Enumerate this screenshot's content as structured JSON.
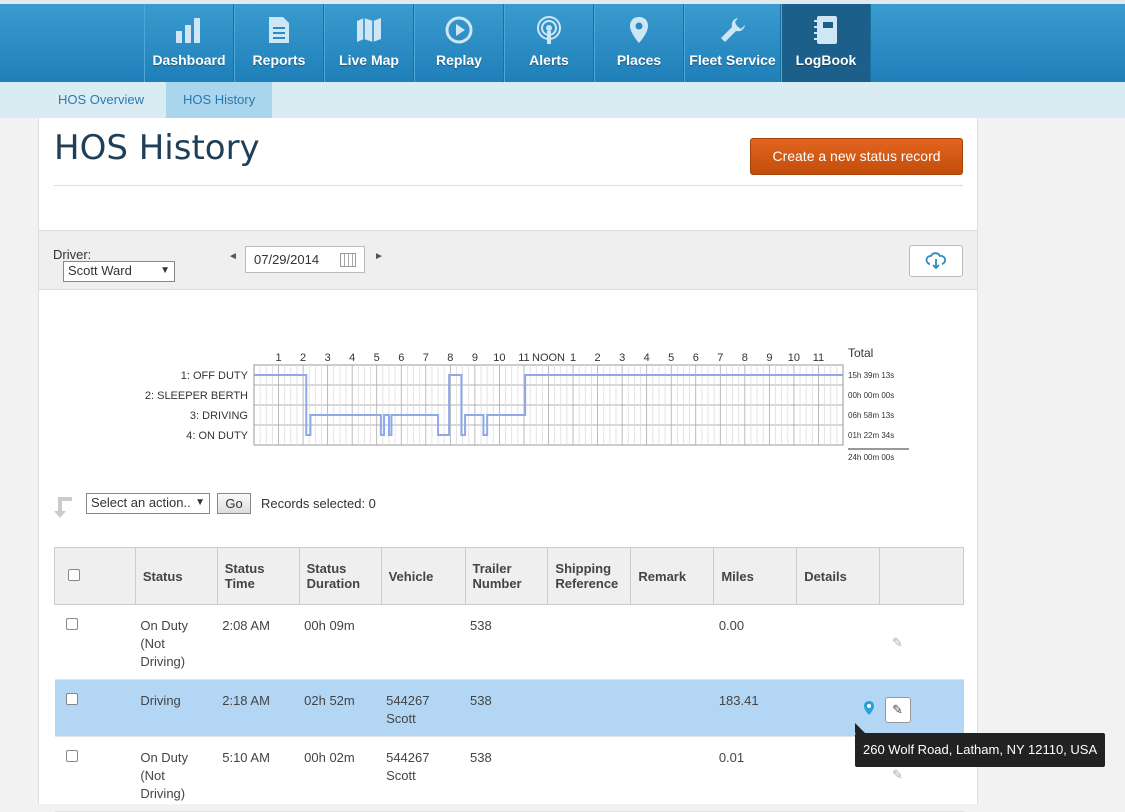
{
  "nav": {
    "items": [
      {
        "label": "Dashboard",
        "icon": "bar-chart-icon"
      },
      {
        "label": "Reports",
        "icon": "document-icon"
      },
      {
        "label": "Live Map",
        "icon": "map-icon"
      },
      {
        "label": "Replay",
        "icon": "play-icon"
      },
      {
        "label": "Alerts",
        "icon": "broadcast-icon"
      },
      {
        "label": "Places",
        "icon": "map-pin-icon"
      },
      {
        "label": "Fleet Service",
        "icon": "wrench-icon"
      },
      {
        "label": "LogBook",
        "icon": "notebook-icon"
      }
    ],
    "active": "LogBook"
  },
  "subnav": {
    "tabs": [
      {
        "label": "HOS Overview"
      },
      {
        "label": "HOS History"
      }
    ],
    "active": "HOS History"
  },
  "page": {
    "title": "HOS History",
    "create_button": "Create a new status record"
  },
  "filter": {
    "driver_label": "Driver:",
    "driver_value": "Scott Ward",
    "date": "07/29/2014"
  },
  "hos_chart": {
    "hour_labels": [
      "1",
      "2",
      "3",
      "4",
      "5",
      "6",
      "7",
      "8",
      "9",
      "10",
      "11",
      "NOON",
      "1",
      "2",
      "3",
      "4",
      "5",
      "6",
      "7",
      "8",
      "9",
      "10",
      "11"
    ],
    "status_labels": [
      "1: OFF DUTY",
      "2: SLEEPER BERTH",
      "3: DRIVING",
      "4: ON DUTY"
    ],
    "total_label": "Total",
    "totals": [
      "15h 39m 13s",
      "00h 00m 00s",
      "06h 58m 13s",
      "01h 22m 34s"
    ],
    "grand_total": "24h 00m 00s",
    "segments": [
      {
        "start": 0.0,
        "end": 2.13,
        "status": 1
      },
      {
        "start": 2.13,
        "end": 2.3,
        "status": 4
      },
      {
        "start": 2.3,
        "end": 5.17,
        "status": 3
      },
      {
        "start": 5.17,
        "end": 5.3,
        "status": 4
      },
      {
        "start": 5.3,
        "end": 5.5,
        "status": 3
      },
      {
        "start": 5.5,
        "end": 5.6,
        "status": 4
      },
      {
        "start": 5.6,
        "end": 7.5,
        "status": 3
      },
      {
        "start": 7.5,
        "end": 7.95,
        "status": 4
      },
      {
        "start": 7.95,
        "end": 8.45,
        "status": 1
      },
      {
        "start": 8.45,
        "end": 8.6,
        "status": 4
      },
      {
        "start": 8.6,
        "end": 9.35,
        "status": 3
      },
      {
        "start": 9.35,
        "end": 9.5,
        "status": 4
      },
      {
        "start": 9.5,
        "end": 11.05,
        "status": 3
      },
      {
        "start": 11.05,
        "end": 24.0,
        "status": 1
      }
    ],
    "line_color": "#8ea8e8"
  },
  "actions": {
    "select_label": "Select an action..",
    "go_label": "Go",
    "records_selected": "Records selected: 0"
  },
  "table": {
    "headers": [
      "Status",
      "Status Time",
      "Status Duration",
      "Vehicle",
      "Trailer Number",
      "Shipping Reference",
      "Remark",
      "Miles",
      "Details"
    ],
    "rows": [
      {
        "status": "On Duty (Not Driving)",
        "time": "2:08 AM",
        "duration": "00h 09m",
        "vehicle": "",
        "trailer": "538",
        "shipping": "",
        "remark": "",
        "miles": "0.00"
      },
      {
        "status": "Driving",
        "time": "2:18 AM",
        "duration": "02h 52m",
        "vehicle": "544267 Scott",
        "trailer": "538",
        "shipping": "",
        "remark": "",
        "miles": "183.41"
      },
      {
        "status": "On Duty (Not Driving)",
        "time": "5:10 AM",
        "duration": "00h 02m",
        "vehicle": "544267 Scott",
        "trailer": "538",
        "shipping": "",
        "remark": "",
        "miles": "0.01"
      }
    ]
  },
  "tooltip": {
    "text": "260 Wolf Road, Latham, NY 12110, USA"
  },
  "colors": {
    "nav_blue": "#2a8cc5",
    "nav_active": "#1b5f8a",
    "create_orange": "#d85a14",
    "highlight_row": "#b3d6f5"
  }
}
